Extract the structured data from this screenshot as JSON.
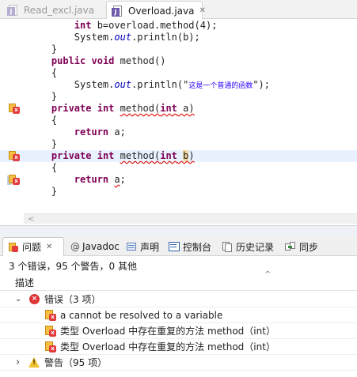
{
  "editor_tabs": [
    {
      "label": "Read_excl.java"
    },
    {
      "label": "Overload.java",
      "close": "✕"
    }
  ],
  "code": {
    "l1_a": "int",
    "l1_b": " b=overload.method(4);",
    "l2_a": "System.",
    "l2_b": "out",
    "l2_c": ".println(b);",
    "l3": "}",
    "l4_a": "public",
    "l4_b": " ",
    "l4_c": "void",
    "l4_d": " method()",
    "l5": "{",
    "l6_a": "System.",
    "l6_b": "out",
    "l6_c": ".println(\"",
    "l6_d": "这是一个普通的函数",
    "l6_e": "\");",
    "l7": "}",
    "l8_a": "private",
    "l8_b": " ",
    "l8_c": "int",
    "l8_d": " ",
    "l8_e": "method(",
    "l8_f": "int",
    "l8_g": " a)",
    "l9": "{",
    "l10_a": "return",
    "l10_b": " a;",
    "l11": "}",
    "l12_a": "private",
    "l12_b": " ",
    "l12_c": "int",
    "l12_d": " ",
    "l12_e": "method(",
    "l12_f": "int",
    "l12_g": " ",
    "l12_h": "b",
    "l12_i": ")",
    "l13": "{",
    "l14_a": "return",
    "l14_b": " ",
    "l14_c": "a",
    "l14_d": ";",
    "l15": "}"
  },
  "hscroll_arrow": "<",
  "view_tabs": [
    {
      "label": "问题",
      "close": "✕"
    },
    {
      "label": "Javadoc",
      "icon_glyph": "@"
    },
    {
      "label": "声明"
    },
    {
      "label": "控制台"
    },
    {
      "label": "历史记录"
    },
    {
      "label": "同步"
    }
  ],
  "summary": "3 个错误，95 个警告，0 其他",
  "column_header": "描述",
  "sort_glyph": "^",
  "tree": {
    "errors_group": {
      "label": "错误（3 项）",
      "chevron": "⌄"
    },
    "error_items": [
      {
        "text": "a cannot be resolved to a variable"
      },
      {
        "text": "类型 Overload 中存在重复的方法 method（int）"
      },
      {
        "text": "类型 Overload 中存在重复的方法 method（int）"
      }
    ],
    "warnings_group": {
      "label": "警告（95 项）",
      "chevron": "›"
    }
  },
  "colors": {
    "keyword": "#7f0055",
    "field": "#0000c0",
    "string": "#2a00ff",
    "current_line": "#e8f2fe",
    "error_red": "#dd3333",
    "warning_yellow": "#f2c230"
  },
  "icons": [
    "java-file-icon",
    "close-icon",
    "error-marker-icon",
    "problems-icon",
    "javadoc-icon",
    "declaration-icon",
    "console-icon",
    "history-icon",
    "sync-icon",
    "error-circle-icon",
    "warning-triangle-icon",
    "chevron-icon"
  ]
}
